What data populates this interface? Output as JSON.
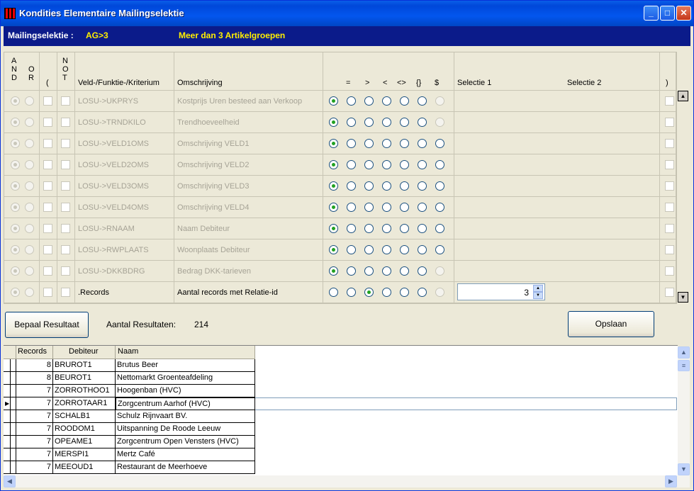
{
  "window": {
    "title": "Kondities Elementaire Mailingselektie",
    "min": "_",
    "max": "□",
    "close": "✕"
  },
  "header": {
    "label": "Mailingselektie :",
    "code": "AG>3",
    "description": "Meer dan 3 Artikelgroepen"
  },
  "columns": {
    "and": "A\nN\nD",
    "or": "O\nR",
    "open_paren": "(",
    "not": "N\nO\nT",
    "criterium": "Veld-/Funktie-/Kriterium",
    "omschrijving": "Omschrijving",
    "eq": "=",
    "gt": ">",
    "lt": "<",
    "ne": "<>",
    "braces": "{}",
    "dollar": "$",
    "selectie1": "Selectie 1",
    "selectie2": "Selectie 2",
    "close_paren": ")"
  },
  "rows": [
    {
      "criterium": "LOSU->UKPRYS",
      "omschrijving": "Kostprijs Uren besteed aan Verkoop",
      "op": 0,
      "dollar_enabled": false
    },
    {
      "criterium": "LOSU->TRNDKILO",
      "omschrijving": "Trendhoeveelheid",
      "op": 0,
      "dollar_enabled": false
    },
    {
      "criterium": "LOSU->VELD1OMS",
      "omschrijving": "Omschrijving VELD1",
      "op": 0,
      "dollar_enabled": true
    },
    {
      "criterium": "LOSU->VELD2OMS",
      "omschrijving": "Omschrijving VELD2",
      "op": 0,
      "dollar_enabled": true
    },
    {
      "criterium": "LOSU->VELD3OMS",
      "omschrijving": "Omschrijving VELD3",
      "op": 0,
      "dollar_enabled": true
    },
    {
      "criterium": "LOSU->VELD4OMS",
      "omschrijving": "Omschrijving VELD4",
      "op": 0,
      "dollar_enabled": true
    },
    {
      "criterium": "LOSU->RNAAM",
      "omschrijving": "Naam Debiteur",
      "op": 0,
      "dollar_enabled": true
    },
    {
      "criterium": "LOSU->RWPLAATS",
      "omschrijving": "Woonplaats Debiteur",
      "op": 0,
      "dollar_enabled": true
    },
    {
      "criterium": "LOSU->DKKBDRG",
      "omschrijving": "Bedrag DKK-tarieven",
      "op": 0,
      "dollar_enabled": false
    },
    {
      "criterium": ".Records",
      "omschrijving": "Aantal records met Relatie-id",
      "op": 2,
      "dollar_enabled": false,
      "active": true
    }
  ],
  "selectie1_value": "3",
  "buttons": {
    "bepaal": "Bepaal Resultaat",
    "opslaan": "Opslaan"
  },
  "results": {
    "label": "Aantal Resultaten:",
    "count": "214"
  },
  "table": {
    "headers": [
      "Records",
      "Debiteur",
      "Naam"
    ],
    "rows": [
      {
        "records": "8",
        "debiteur": "BRUROT1",
        "naam": "Brutus Beer"
      },
      {
        "records": "8",
        "debiteur": "BEUROT1",
        "naam": "Nettomarkt Groenteafdeling"
      },
      {
        "records": "7",
        "debiteur": "ZORROTHOO1",
        "naam": "Hoogenban (HVC)"
      },
      {
        "records": "7",
        "debiteur": "ZORROTAAR1",
        "naam": "Zorgcentrum Aarhof (HVC)",
        "selected": true
      },
      {
        "records": "7",
        "debiteur": "SCHALB1",
        "naam": "Schulz Rijnvaart BV."
      },
      {
        "records": "7",
        "debiteur": "ROODOM1",
        "naam": "Uitspanning De Roode Leeuw"
      },
      {
        "records": "7",
        "debiteur": "OPEAME1",
        "naam": "Zorgcentrum Open Vensters (HVC)"
      },
      {
        "records": "7",
        "debiteur": "MERSPI1",
        "naam": "Mertz Café"
      },
      {
        "records": "7",
        "debiteur": "MEEOUD1",
        "naam": "Restaurant de Meerhoeve"
      }
    ]
  }
}
